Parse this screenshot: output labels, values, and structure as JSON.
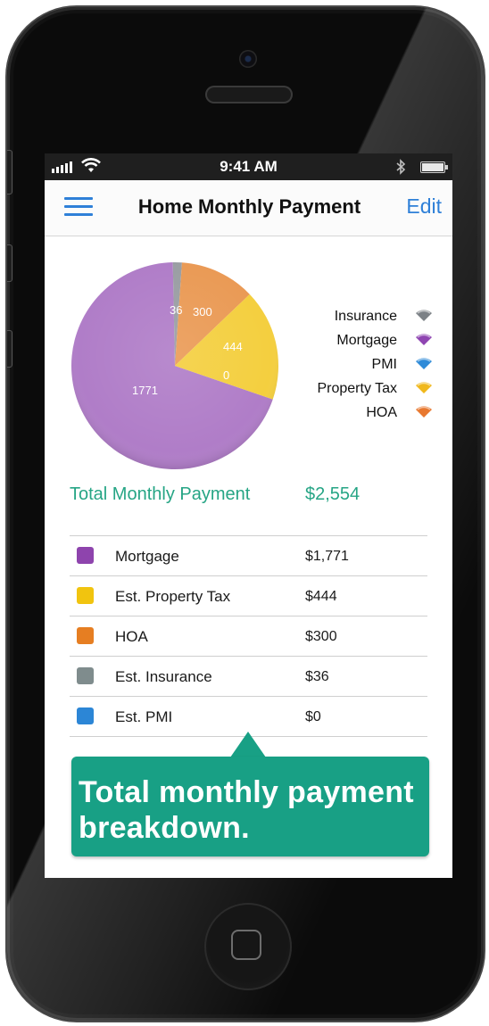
{
  "status_bar": {
    "time": "9:41 AM"
  },
  "nav": {
    "title": "Home Monthly Payment",
    "edit_label": "Edit"
  },
  "chart_data": {
    "type": "pie",
    "slices": [
      {
        "label": "Mortgage",
        "value": 1771,
        "color": "#b07dc8",
        "label_color": "#ffffff"
      },
      {
        "label": "Insurance",
        "value": 36,
        "color": "#9a9ea3",
        "label_color": "#ffffff"
      },
      {
        "label": "HOA",
        "value": 300,
        "color": "#ea9a55",
        "label_color": "#ffffff"
      },
      {
        "label": "Property Tax",
        "value": 444,
        "color": "#f4cf3f",
        "label_color": "#ffffff"
      },
      {
        "label": "PMI",
        "value": 0,
        "color": "#2f8bd8",
        "label_color": "#ffffff"
      }
    ],
    "legend": [
      {
        "label": "Insurance",
        "color": "#7c8186"
      },
      {
        "label": "Mortgage",
        "color": "#8f45b2"
      },
      {
        "label": "PMI",
        "color": "#2f8bd8"
      },
      {
        "label": "Property Tax",
        "color": "#f0b81c"
      },
      {
        "label": "HOA",
        "color": "#e8782f"
      }
    ],
    "legend_position": "right"
  },
  "summary": {
    "label": "Total Monthly Payment",
    "value": "$2,554"
  },
  "breakdown": [
    {
      "name": "Mortgage",
      "amount": "$1,771",
      "color": "#8e44ad"
    },
    {
      "name": "Est. Property Tax",
      "amount": "$444",
      "color": "#f1c40f"
    },
    {
      "name": "HOA",
      "amount": "$300",
      "color": "#e67e22"
    },
    {
      "name": "Est. Insurance",
      "amount": "$36",
      "color": "#7f8c8d"
    },
    {
      "name": "Est. PMI",
      "amount": "$0",
      "color": "#2c86d6"
    }
  ],
  "callout": {
    "text": "Total monthly payment breakdown."
  }
}
